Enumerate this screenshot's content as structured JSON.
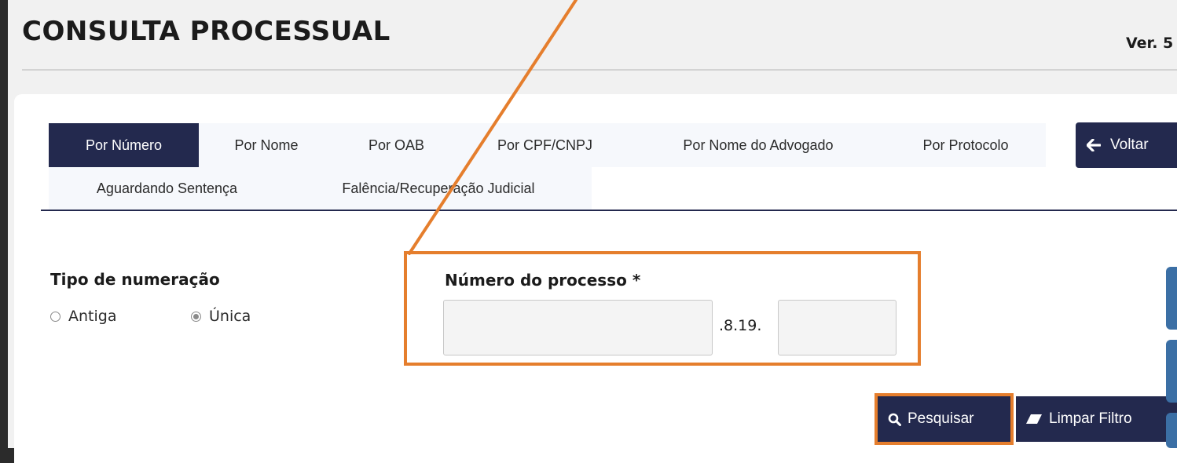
{
  "header": {
    "title": "CONSULTA PROCESSUAL",
    "version": "Ver. 5"
  },
  "tabs": {
    "row1": [
      "Por Número",
      "Por Nome",
      "Por OAB",
      "Por CPF/CNPJ",
      "Por Nome do Advogado",
      "Por Protocolo"
    ],
    "row2": [
      "Aguardando Sentença",
      "Falência/Recuperação Judicial"
    ],
    "active": "Por Número",
    "back_label": "Voltar"
  },
  "form": {
    "numbering_label": "Tipo de numeração",
    "options": [
      "Antiga",
      "Única"
    ],
    "selected_option": "Única",
    "process_label": "Número do processo *",
    "process_value": "",
    "separator": ".8.19.",
    "suffix_value": ""
  },
  "actions": {
    "search_label": "Pesquisar",
    "clear_label": "Limpar Filtro"
  },
  "annotations": {
    "highlight_color": "#e57e2d"
  },
  "colors": {
    "primary": "#23294e",
    "background": "#f1f1f1"
  }
}
